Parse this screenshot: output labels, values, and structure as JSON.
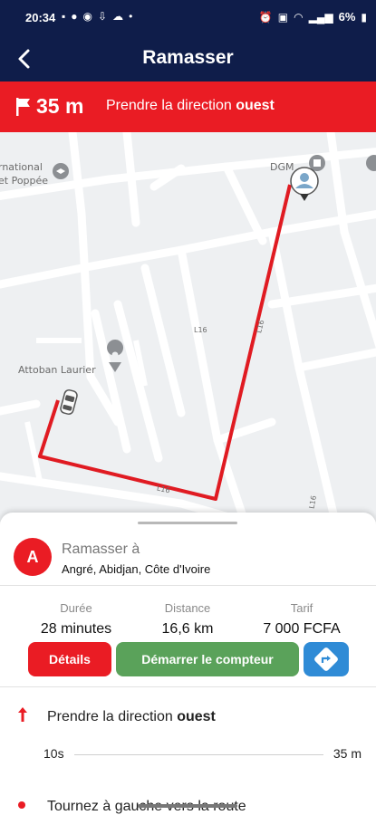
{
  "status_bar": {
    "time": "20:34",
    "battery": "6%"
  },
  "header": {
    "title": "Ramasser"
  },
  "banner": {
    "distance": "35 m",
    "instruction_prefix": "Prendre la direction",
    "instruction_direction": "ouest",
    "color": "#ea1c24"
  },
  "map": {
    "labels": {
      "place_1_line1": "rnational",
      "place_1_line2": "et Poppée",
      "place_2": "Attoban Laurier",
      "place_3": "DGM",
      "street_1": "L16",
      "street_2": "L16",
      "street_3": "L16",
      "street_4": "L16"
    },
    "route_color": "#e01b22"
  },
  "pickup": {
    "badge": "A",
    "title": "Ramasser à",
    "address": "Angré, Abidjan, Côte d'Ivoire"
  },
  "stats": {
    "duration_label": "Durée",
    "duration_value": "28 minutes",
    "distance_label": "Distance",
    "distance_value": "16,6 km",
    "fare_label": "Tarif",
    "fare_value": "7 000  FCFA"
  },
  "actions": {
    "details_label": "Détails",
    "start_meter_label": "Démarrer le compteur",
    "details_color": "#ea1c24",
    "start_color": "#5aa25a",
    "nav_color": "#2f8bd6"
  },
  "step": {
    "instruction_prefix": "Prendre la direction",
    "instruction_direction": "ouest",
    "time": "10s",
    "distance": "35 m"
  },
  "next_step": {
    "text": "Tournez à gauche vers la route"
  }
}
